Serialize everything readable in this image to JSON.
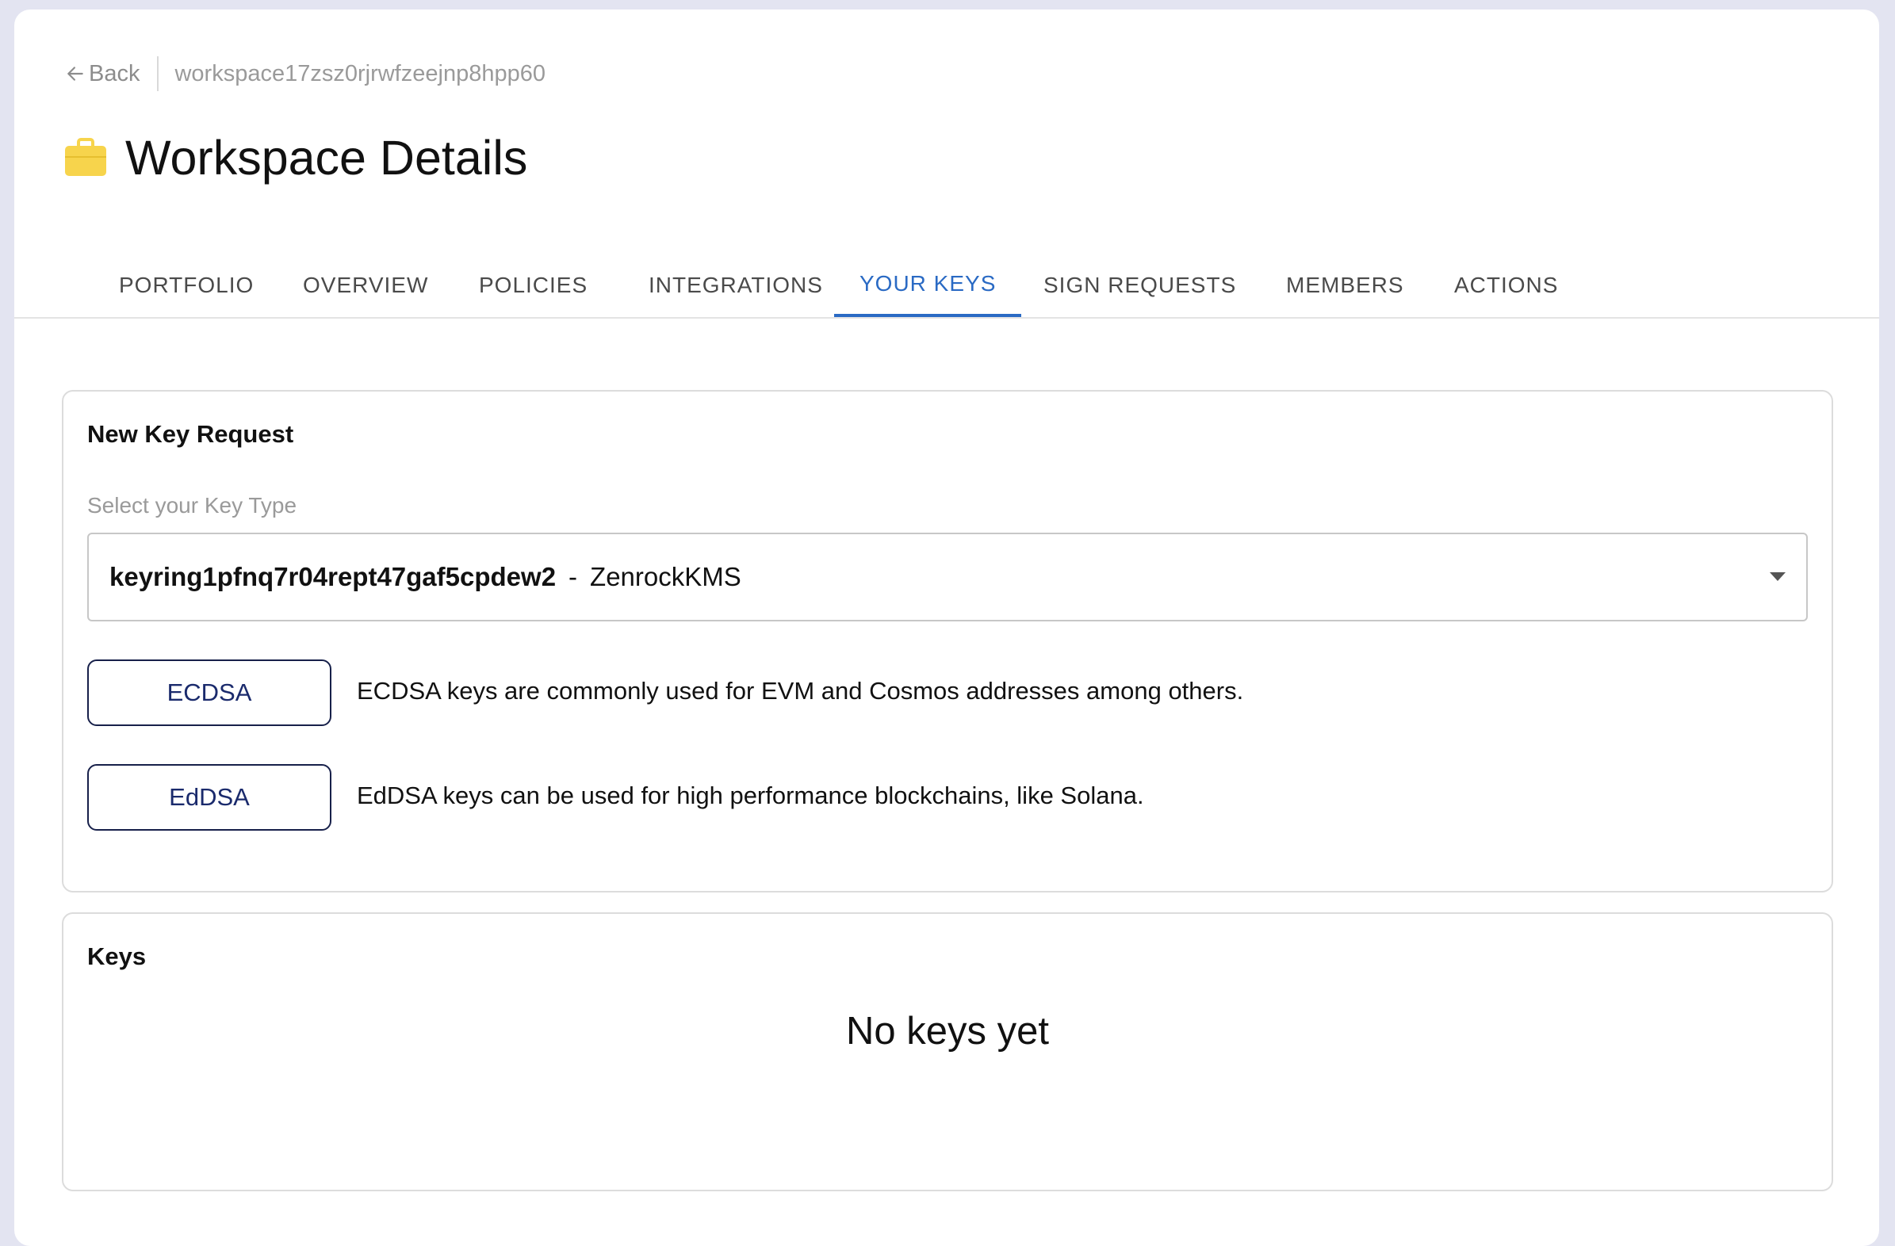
{
  "breadcrumb": {
    "back_label": "Back",
    "workspace_id": "workspace17zsz0rjrwfzeejnp8hpp60"
  },
  "header": {
    "title": "Workspace Details",
    "icon": "briefcase-icon",
    "icon_color": "#f7d44c"
  },
  "tabs": [
    {
      "label": "PORTFOLIO",
      "active": false
    },
    {
      "label": "OVERVIEW",
      "active": false
    },
    {
      "label": "POLICIES",
      "active": false
    },
    {
      "label": "INTEGRATIONS",
      "active": false
    },
    {
      "label": "YOUR KEYS",
      "active": true
    },
    {
      "label": "SIGN REQUESTS",
      "active": false
    },
    {
      "label": "MEMBERS",
      "active": false
    },
    {
      "label": "ACTIONS",
      "active": false
    }
  ],
  "new_key_request": {
    "title": "New Key Request",
    "select_label": "Select your Key Type",
    "selected_keyring": "keyring1pfnq7r04rept47gaf5cpdew2",
    "separator": "-",
    "selected_provider": "ZenrockKMS",
    "options": [
      {
        "button": "ECDSA",
        "description": "ECDSA keys are commonly used for EVM and Cosmos addresses among others."
      },
      {
        "button": "EdDSA",
        "description": "EdDSA keys can be used for high performance blockchains, like Solana."
      }
    ]
  },
  "keys": {
    "title": "Keys",
    "empty_message": "No keys yet"
  },
  "colors": {
    "accent": "#2a6ac4",
    "button_border": "#17204a",
    "background": "#e3e4f1"
  }
}
